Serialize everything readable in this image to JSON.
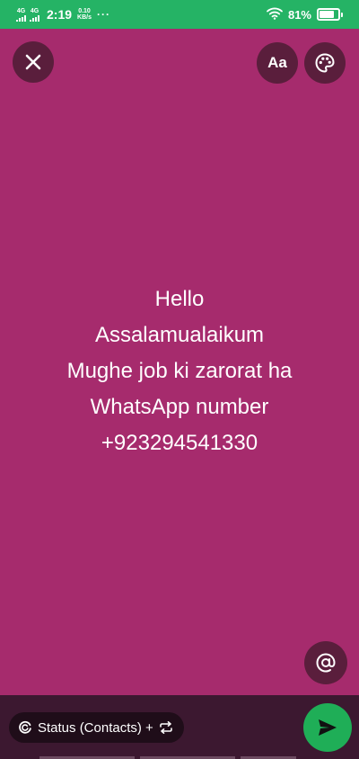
{
  "status_bar": {
    "network1": "4G",
    "network2": "4G",
    "time": "2:19",
    "speed_value": "0.10",
    "speed_unit": "KB/s",
    "more": "···",
    "battery": "81%",
    "battery_level": 0.81
  },
  "toolbar": {
    "close_icon": "close-icon",
    "font_label": "Aa",
    "palette_icon": "palette-icon"
  },
  "status_text": [
    "Hello",
    "Assalamualaikum",
    "Mughe job ki zarorat ha",
    "WhatsApp number",
    "+923294541330"
  ],
  "mention_icon": "at-icon",
  "bottom": {
    "audience_label": "Status (Contacts) +",
    "send_icon": "send-icon"
  },
  "colors": {
    "background": "#a62b6d",
    "status_bar": "#25b365",
    "send_button": "#1fae57"
  }
}
